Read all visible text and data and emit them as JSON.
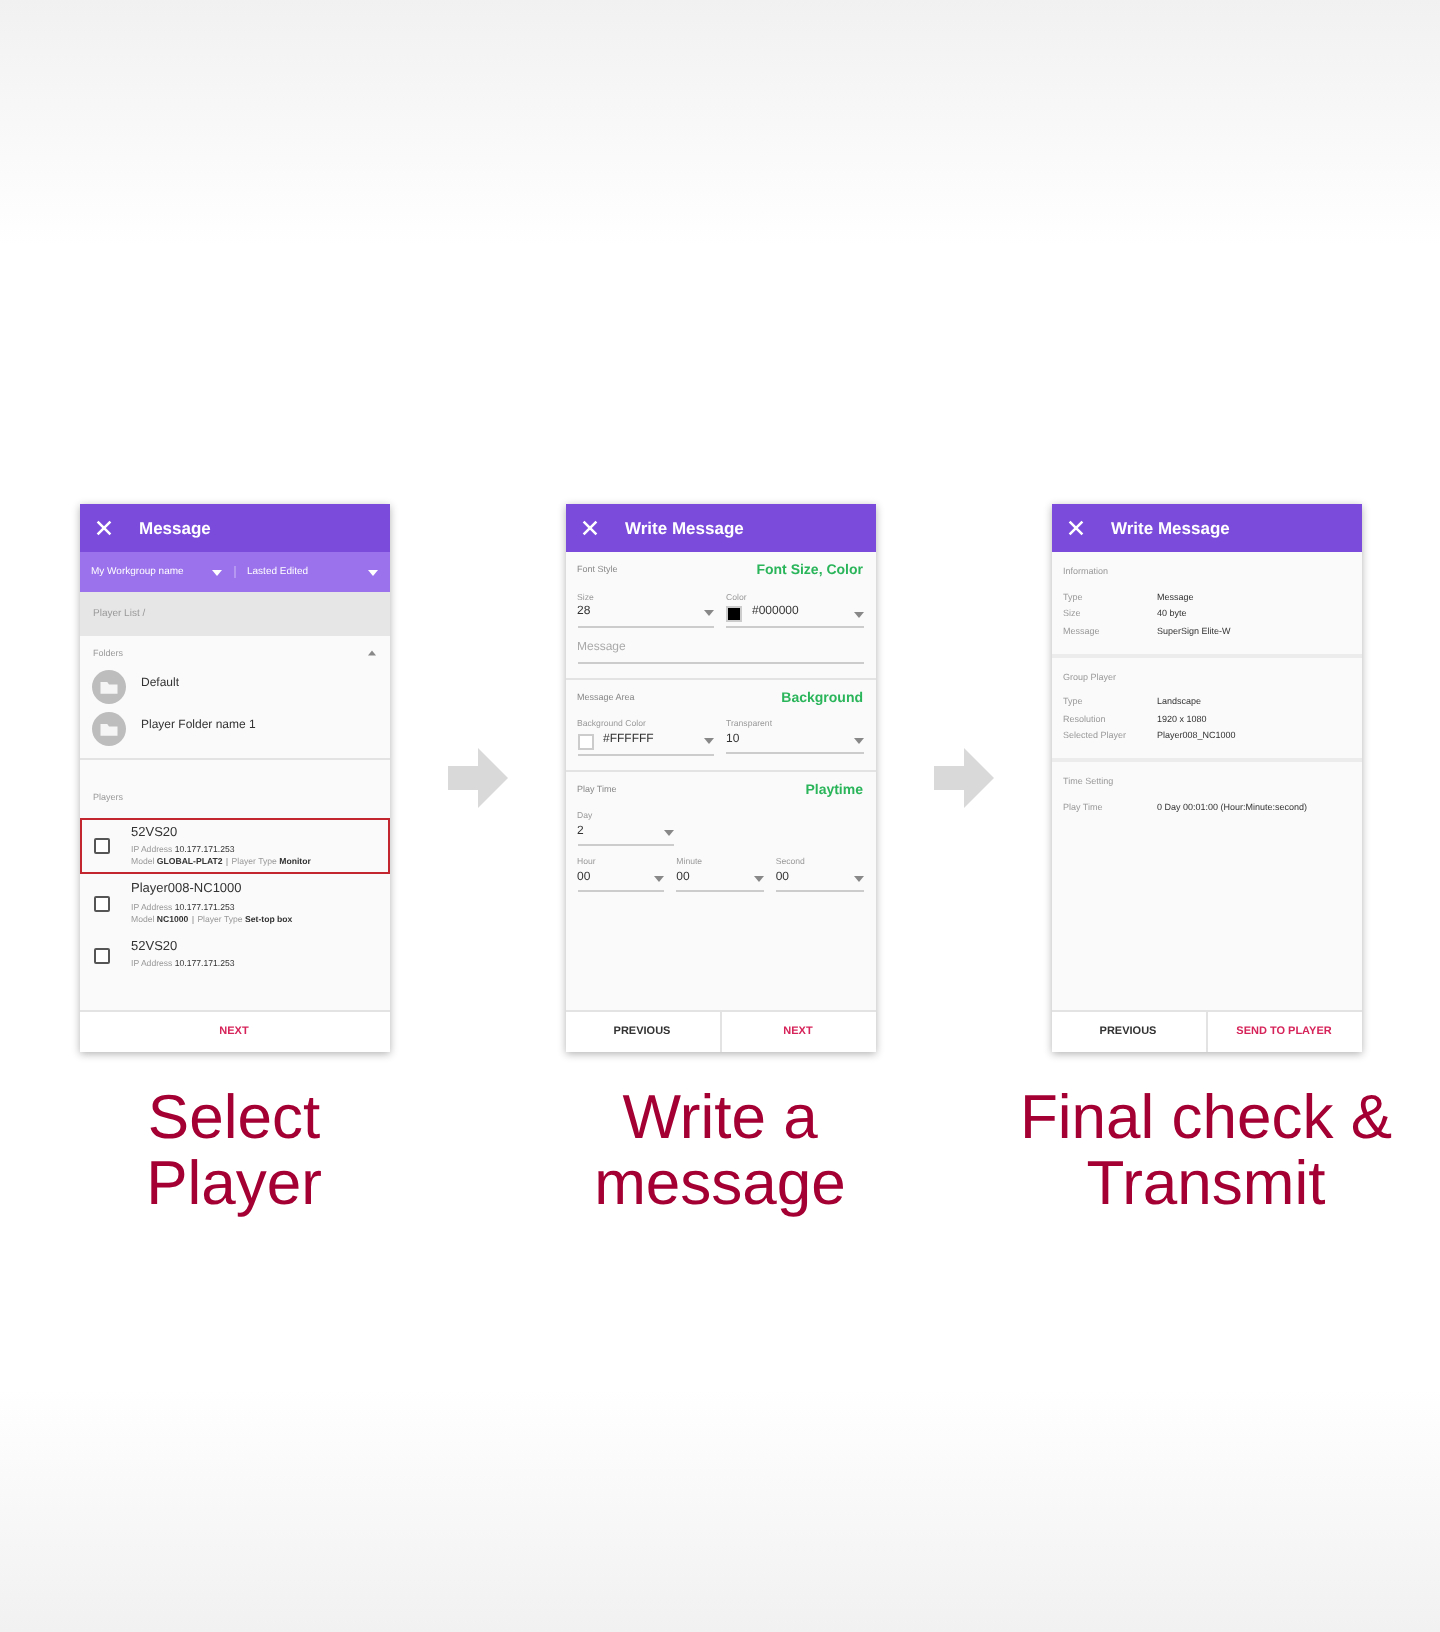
{
  "steps": [
    {
      "kind": "select",
      "title": "Message",
      "filters": [
        "My Workgroup name",
        "Lasted Edited"
      ],
      "breadcrumb": "Player List /",
      "folders_label": "Folders",
      "folders": [
        "Default",
        "Player Folder name 1"
      ],
      "players_label": "Players",
      "players": [
        {
          "name": "52VS20",
          "ip_label": "IP Address",
          "ip": "10.177.171.253",
          "model_label": "Model",
          "model": "GLOBAL-PLAT2",
          "type_label": "Player Type",
          "type": "Monitor",
          "selected": true,
          "checked": false
        },
        {
          "name": "Player008-NC1000",
          "ip_label": "IP Address",
          "ip": "10.177.171.253",
          "model_label": "Model",
          "model": "NC1000",
          "type_label": "Player Type",
          "type": "Set-top box",
          "selected": false,
          "checked": false
        },
        {
          "name": "52VS20",
          "ip_label": "IP Address",
          "ip": "10.177.171.253",
          "selected": false,
          "checked": false
        }
      ],
      "buttons": [
        {
          "label": "NEXT",
          "primary": true
        }
      ],
      "caption": [
        "Select",
        "Player"
      ]
    },
    {
      "kind": "write",
      "title": "Write Message",
      "sections": [
        {
          "label": "Font Style",
          "hint": "Font Size, Color",
          "rows": [
            [
              {
                "label": "Size",
                "value": "28"
              },
              {
                "label": "Color",
                "value": "#000000",
                "color": "#000000"
              }
            ],
            [
              {
                "placeholder": "Message"
              }
            ]
          ]
        },
        {
          "label": "Message Area",
          "hint": "Background",
          "rows": [
            [
              {
                "label": "Background Color",
                "value": "#FFFFFF",
                "color": "#ffffff"
              },
              {
                "label": "Transparent",
                "value": "10"
              }
            ]
          ]
        },
        {
          "label": "Play Time",
          "hint": "Playtime",
          "rows": [
            [
              {
                "label": "Day",
                "value": "2"
              }
            ],
            [
              {
                "label": "Hour",
                "value": "00"
              },
              {
                "label": "Minute",
                "value": "00"
              },
              {
                "label": "Second",
                "value": "00"
              }
            ]
          ]
        }
      ],
      "buttons": [
        {
          "label": "PREVIOUS",
          "primary": false
        },
        {
          "label": "NEXT",
          "primary": true
        }
      ],
      "caption": [
        "Write a",
        "message"
      ]
    },
    {
      "kind": "confirm",
      "title": "Write Message",
      "sections": [
        {
          "label": "Information",
          "rows": [
            [
              "Type",
              "Message"
            ],
            [
              "Size",
              "40 byte"
            ],
            [
              "Message",
              "SuperSign Elite-W"
            ]
          ]
        },
        {
          "label": "Group Player",
          "rows": [
            [
              "Type",
              "Landscape"
            ],
            [
              "Resolution",
              "1920 x 1080"
            ],
            [
              "Selected Player",
              "Player008_NC1000"
            ]
          ]
        },
        {
          "label": "Time Setting",
          "rows": [
            [
              "Play Time",
              "0 Day 00:01:00 (Hour:Minute:second)"
            ]
          ]
        }
      ],
      "buttons": [
        {
          "label": "PREVIOUS",
          "primary": false
        },
        {
          "label": "SEND TO PLAYER",
          "primary": true
        }
      ],
      "caption": [
        "Final check &",
        "Transmit"
      ]
    }
  ]
}
